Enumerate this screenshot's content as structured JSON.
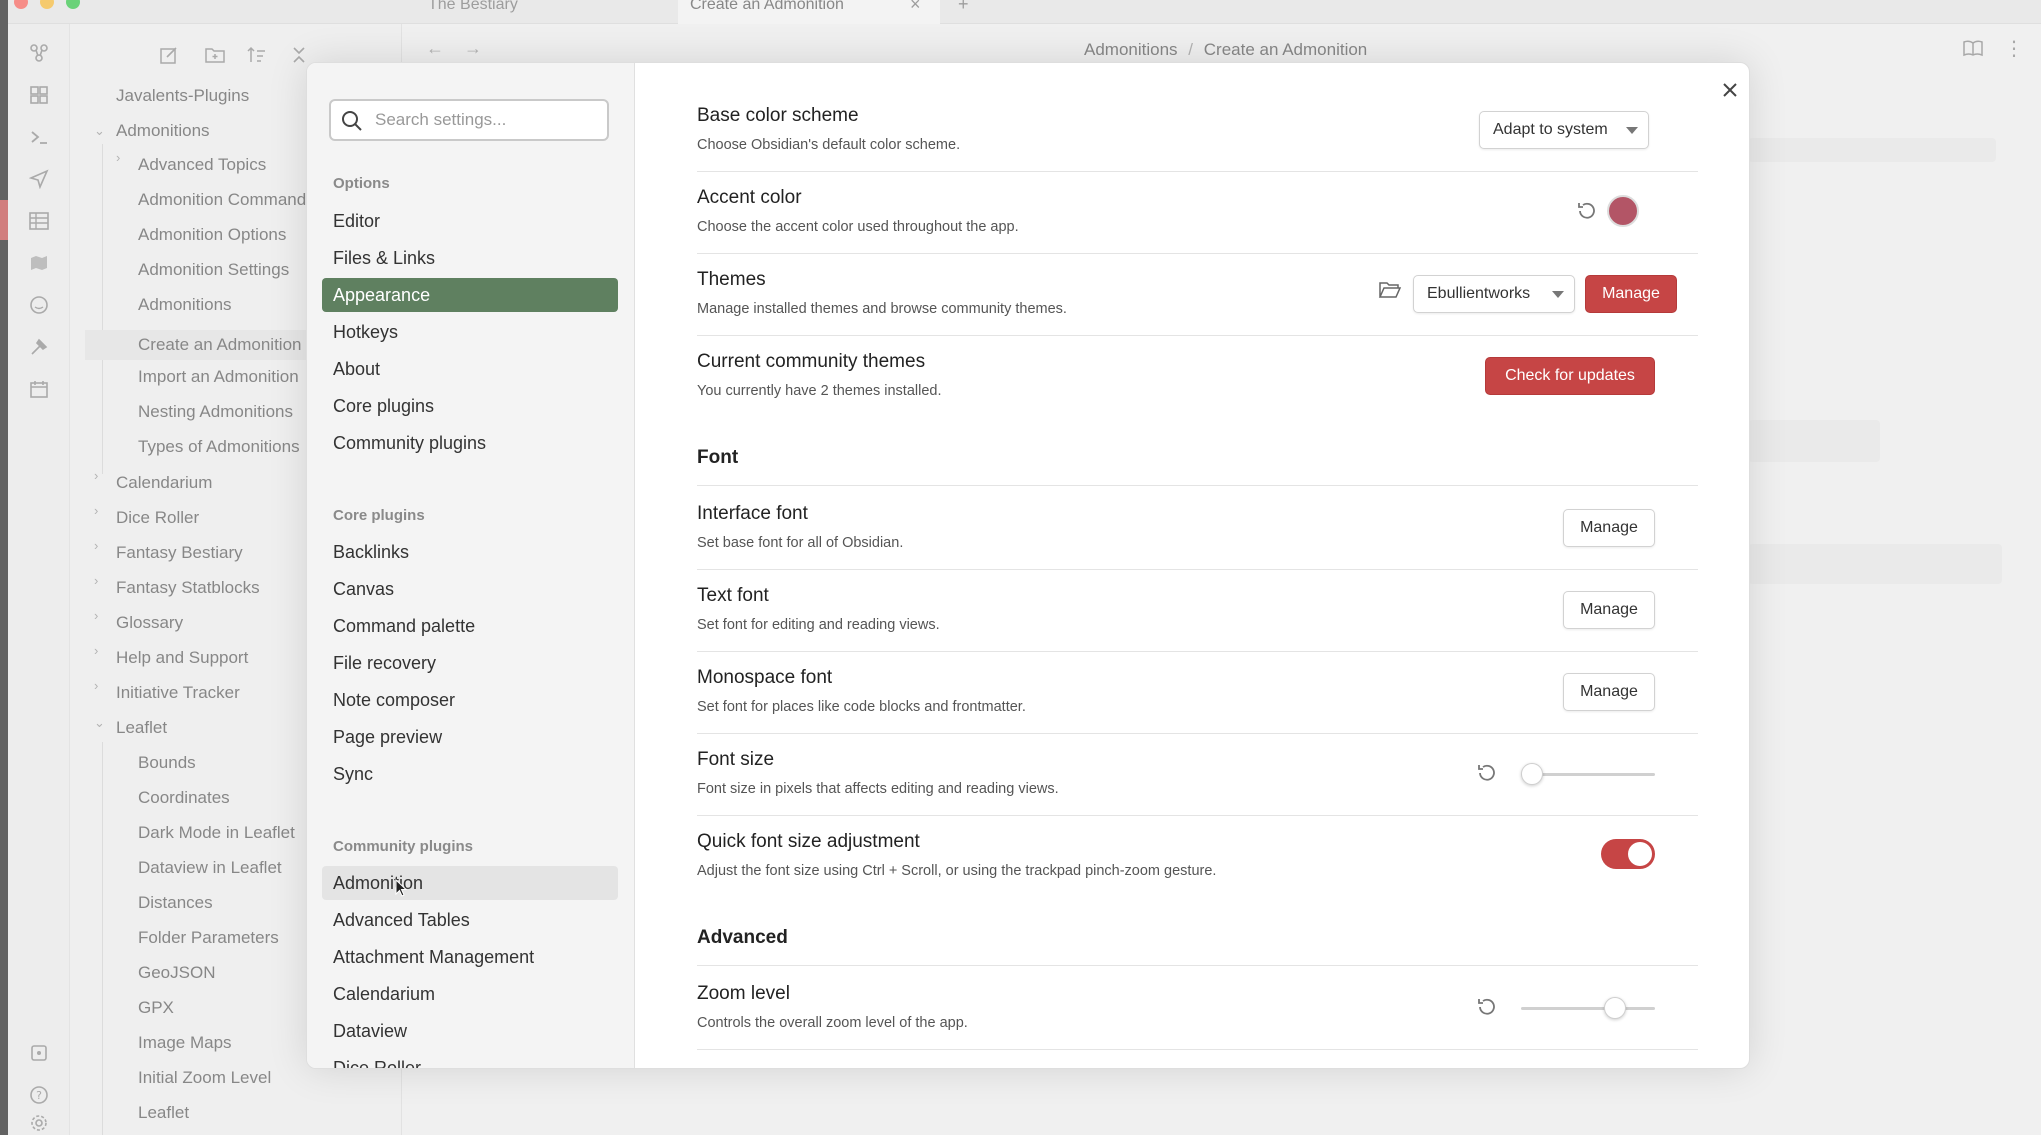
{
  "window": {
    "tabs": [
      {
        "label": "The Bestiary"
      },
      {
        "label": "Create an Admonition"
      }
    ]
  },
  "breadcrumb": {
    "parent": "Admonitions",
    "separator": "/",
    "current": "Create an Admonition"
  },
  "explorer": {
    "vault": "Javalents-Plugins",
    "tree": [
      {
        "label": "Admonitions"
      },
      {
        "label": "Advanced Topics"
      },
      {
        "label": "Admonition Commands"
      },
      {
        "label": "Admonition Options"
      },
      {
        "label": "Admonition Settings"
      },
      {
        "label": "Admonitions"
      },
      {
        "label": "Create an Admonition"
      },
      {
        "label": "Import an Admonition"
      },
      {
        "label": "Nesting Admonitions"
      },
      {
        "label": "Types of Admonitions"
      },
      {
        "label": "Calendarium"
      },
      {
        "label": "Dice Roller"
      },
      {
        "label": "Fantasy Bestiary"
      },
      {
        "label": "Fantasy Statblocks"
      },
      {
        "label": "Glossary"
      },
      {
        "label": "Help and Support"
      },
      {
        "label": "Initiative Tracker"
      },
      {
        "label": "Leaflet"
      },
      {
        "label": "Bounds"
      },
      {
        "label": "Coordinates"
      },
      {
        "label": "Dark Mode in Leaflet"
      },
      {
        "label": "Dataview in Leaflet"
      },
      {
        "label": "Distances"
      },
      {
        "label": "Folder Parameters"
      },
      {
        "label": "GeoJSON"
      },
      {
        "label": "GPX"
      },
      {
        "label": "Image Maps"
      },
      {
        "label": "Initial Zoom Level"
      },
      {
        "label": "Leaflet"
      }
    ]
  },
  "settings": {
    "search_placeholder": "Search settings...",
    "sections": {
      "options": "Options",
      "core": "Core plugins",
      "community": "Community plugins"
    },
    "options_items": [
      "Editor",
      "Files & Links",
      "Appearance",
      "Hotkeys",
      "About",
      "Core plugins",
      "Community plugins"
    ],
    "core_items": [
      "Backlinks",
      "Canvas",
      "Command palette",
      "File recovery",
      "Note composer",
      "Page preview",
      "Sync"
    ],
    "community_items": [
      "Admonition",
      "Advanced Tables",
      "Attachment Management",
      "Calendarium",
      "Dataview",
      "Dice Roller"
    ]
  },
  "appearance": {
    "base_color": {
      "title": "Base color scheme",
      "desc": "Choose Obsidian's default color scheme.",
      "value": "Adapt to system"
    },
    "accent": {
      "title": "Accent color",
      "desc": "Choose the accent color used throughout the app.",
      "color": "#b35566"
    },
    "themes": {
      "title": "Themes",
      "desc": "Manage installed themes and browse community themes.",
      "value": "Ebullientworks",
      "button": "Manage"
    },
    "community_themes": {
      "title": "Current community themes",
      "desc": "You currently have 2 themes installed.",
      "button": "Check for updates"
    },
    "font_section": "Font",
    "interface_font": {
      "title": "Interface font",
      "desc": "Set base font for all of Obsidian.",
      "button": "Manage"
    },
    "text_font": {
      "title": "Text font",
      "desc": "Set font for editing and reading views.",
      "button": "Manage"
    },
    "mono_font": {
      "title": "Monospace font",
      "desc": "Set font for places like code blocks and frontmatter.",
      "button": "Manage"
    },
    "font_size": {
      "title": "Font size",
      "desc": "Font size in pixels that affects editing and reading views.",
      "level": 0.08
    },
    "quick_font": {
      "title": "Quick font size adjustment",
      "desc": "Adjust the font size using Ctrl + Scroll, or using the trackpad pinch-zoom gesture.",
      "enabled": true
    },
    "advanced_section": "Advanced",
    "zoom": {
      "title": "Zoom level",
      "desc": "Controls the overall zoom level of the app.",
      "level": 0.7
    }
  },
  "colors": {
    "accent": "#c64545",
    "active_nav": "#5f8060"
  }
}
